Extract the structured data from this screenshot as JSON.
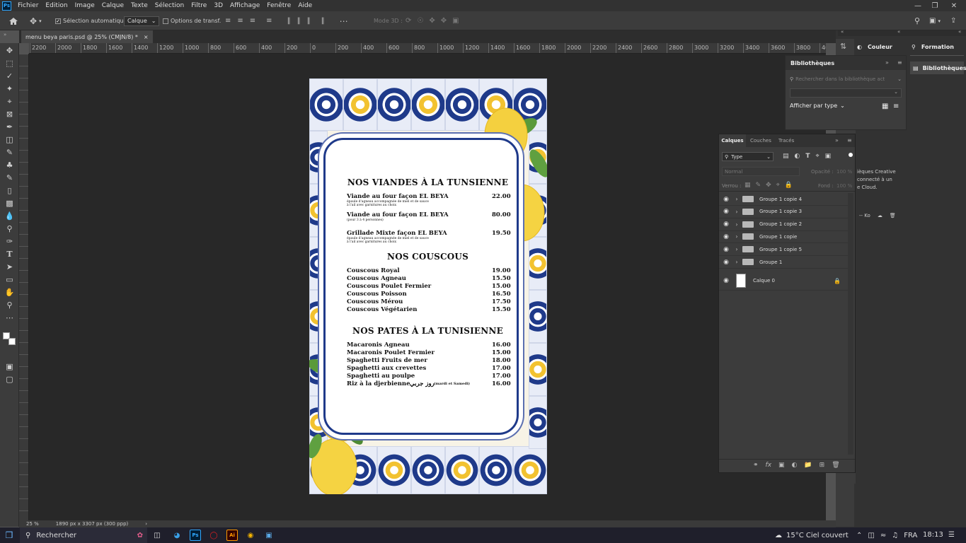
{
  "menubar": {
    "app_logo": "Ps",
    "items": [
      "Fichier",
      "Edition",
      "Image",
      "Calque",
      "Texte",
      "Sélection",
      "Filtre",
      "3D",
      "Affichage",
      "Fenêtre",
      "Aide"
    ]
  },
  "options": {
    "auto_select_label": "Sélection automatique :",
    "auto_select_value": "Calque",
    "transform_label": "Options de transf.",
    "mode3d_label": "Mode 3D :"
  },
  "document": {
    "tab_title": "menu beya paris.psd @ 25% (CMJN/8) *",
    "zoom": "25 %",
    "doc_info": "1890 px x 3307 px (300 ppp)"
  },
  "ruler_ticks": [
    "2200",
    "2000",
    "1800",
    "1600",
    "1400",
    "1200",
    "1000",
    "800",
    "600",
    "400",
    "200",
    "0",
    "200",
    "400",
    "600",
    "800",
    "1000",
    "1200",
    "1400",
    "1600",
    "1800",
    "2000",
    "2200",
    "2400",
    "2600",
    "2800",
    "3000",
    "3200",
    "3400",
    "3600",
    "3800",
    "400"
  ],
  "menu": {
    "sections": [
      {
        "heading": "NOS VIANDES À LA TUNSIENNE",
        "items": [
          {
            "name": "Viande au four façon EL BEYA",
            "desc": "épaule d'agneau accompagnée de miel et de sauce",
            "desc2": "à l'ail avec garnitures au choix",
            "price": "22.00"
          },
          {
            "name": "Viande au four façon EL BEYA",
            "desc": "(pour 3 à 4 personnes)",
            "desc2": "",
            "price": "80.00"
          },
          {
            "name": "Grillade Mixte façon EL BEYA",
            "desc": "épaule d'agneau accompagnée de miel et de sauce",
            "desc2": "à l'ail avec garnitures au choix",
            "price": "19.50"
          }
        ]
      },
      {
        "heading": "NOS COUSCOUS",
        "items": [
          {
            "name": "Couscous Royal",
            "price": "19.00"
          },
          {
            "name": "Couscous Agneau",
            "price": "15.50"
          },
          {
            "name": "Couscous Poulet Fermier",
            "price": "15.00"
          },
          {
            "name": "Couscous Poisson",
            "price": "16.50"
          },
          {
            "name": "Couscous Mérou",
            "price": "17.50"
          },
          {
            "name": "Couscous Végétarien",
            "price": "15.50"
          }
        ]
      },
      {
        "heading": "NOS PATES À LA TUNISIENNE",
        "items": [
          {
            "name": "Macaronis Agneau",
            "price": "16.00"
          },
          {
            "name": "Macaronis Poulet Fermier",
            "price": "15.00"
          },
          {
            "name": "Spaghetti Fruits de mer",
            "price": "18.00"
          },
          {
            "name": "Spaghetti aux crevettes",
            "price": "17.00"
          },
          {
            "name": "Spaghetti au poulpe",
            "price": "17.00"
          },
          {
            "name": "Riz à la djerbienne",
            "extra": "روز جربي",
            "note": "(mardi et Samedi)",
            "price": "16.00"
          }
        ]
      }
    ]
  },
  "right_dock": {
    "couleur": "Couleur",
    "formation": "Formation",
    "bibliotheques_tab": "Bibliothèques",
    "bib_panel_title": "Bibliothèques",
    "bib_search_placeholder": "Rechercher dans la bibliothèque act",
    "show_by_type": "Afficher par type",
    "cc_text_1": "ièques Creative",
    "cc_text_2": "connecté à un",
    "cc_text_3": "e Cloud.",
    "ko_label": "-- Ko"
  },
  "layers_panel": {
    "tabs": [
      "Calques",
      "Couches",
      "Tracés"
    ],
    "filter_label": "Type",
    "blend_mode": "Normal",
    "opacity_label": "Opacité :",
    "opacity_value": "100 %",
    "lock_label": "Verrou :",
    "fill_label": "Fond :",
    "fill_value": "100 %",
    "layers": [
      {
        "name": "Groupe 1 copie 4",
        "type": "group"
      },
      {
        "name": "Groupe 1 copie 3",
        "type": "group"
      },
      {
        "name": "Groupe 1 copie 2",
        "type": "group"
      },
      {
        "name": "Groupe 1 copie",
        "type": "group"
      },
      {
        "name": "Groupe 1 copie 5",
        "type": "group"
      },
      {
        "name": "Groupe 1",
        "type": "group"
      },
      {
        "name": "Calque 0",
        "type": "layer",
        "locked": true
      }
    ]
  },
  "taskbar": {
    "search": "Rechercher",
    "weather": "15°C  Ciel couvert",
    "lang": "FRA",
    "time": "18:13"
  },
  "colors": {
    "tile_blue": "#1f3a8a",
    "tile_yellow": "#f2c230",
    "accent": "#31a8ff"
  }
}
